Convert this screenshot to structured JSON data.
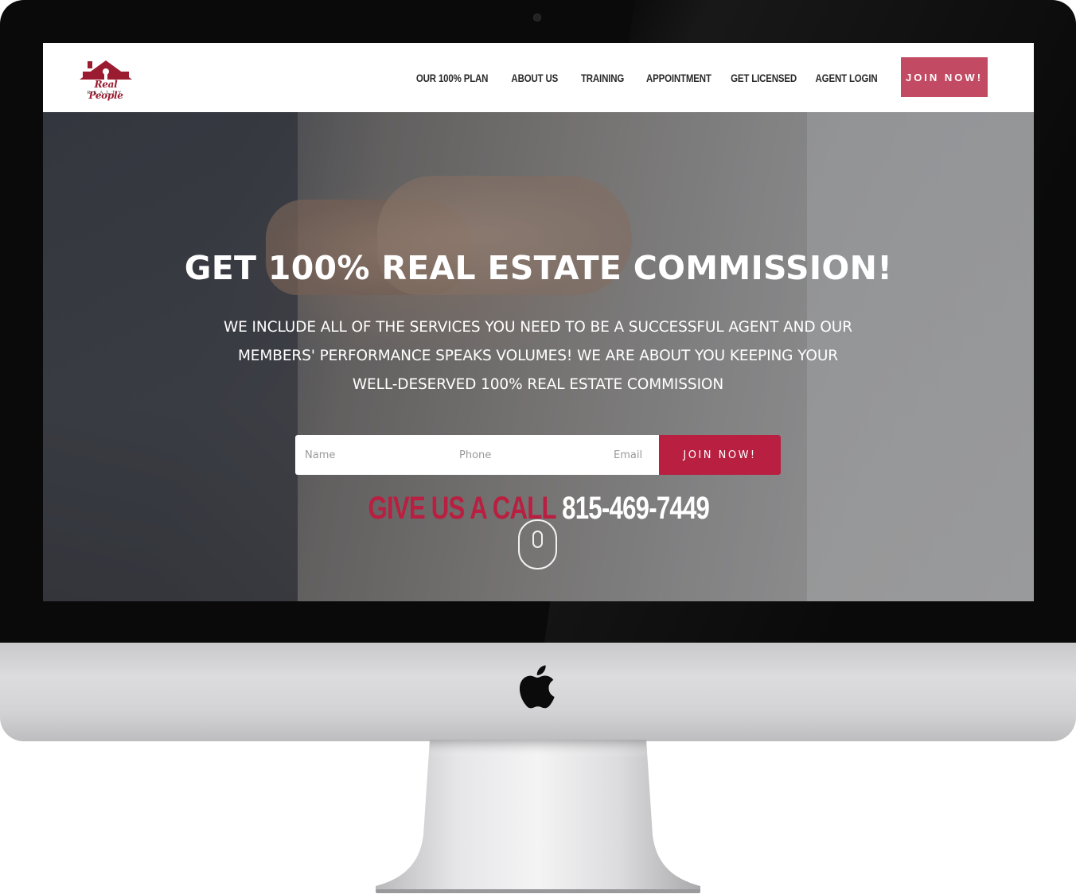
{
  "brand": {
    "logo_name": "Real People",
    "logo_sub": "REALTY",
    "accent_color": "#b81f40",
    "cta_color": "#c24a62"
  },
  "nav": {
    "items": [
      {
        "label": "OUR 100% PLAN"
      },
      {
        "label": "ABOUT US"
      },
      {
        "label": "TRAINING"
      },
      {
        "label": "APPOINTMENT"
      },
      {
        "label": "GET LICENSED"
      },
      {
        "label": "AGENT LOGIN"
      }
    ],
    "cta_label": "JOIN NOW!"
  },
  "hero": {
    "title": "GET 100% REAL ESTATE COMMISSION!",
    "text_lines": [
      "WE INCLUDE ALL OF THE SERVICES YOU NEED TO BE A SUCCESSFUL AGENT AND OUR",
      "MEMBERS' PERFORMANCE SPEAKS VOLUMES! WE ARE ABOUT YOU KEEPING YOUR",
      "WELL-DESERVED 100% REAL ESTATE COMMISSION"
    ],
    "form": {
      "name_placeholder": "Name",
      "phone_placeholder": "Phone",
      "email_placeholder": "Email",
      "submit_label": "JOIN NOW!"
    },
    "call_prefix": "GIVE US A CALL",
    "phone_number": "815-469-7449"
  },
  "icons": {
    "scroll": "mouse-scroll-icon",
    "device_logo": "apple-logo-icon",
    "site_logo": "house-logo-icon"
  }
}
